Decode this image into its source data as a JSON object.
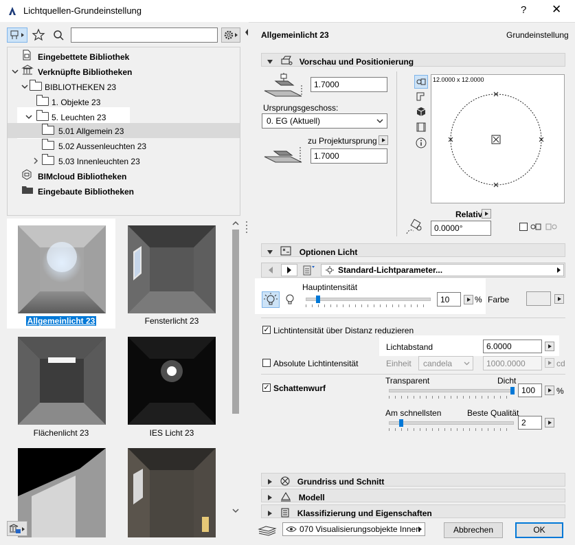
{
  "window": {
    "title": "Lichtquellen-Grundeinstellung",
    "help": "?",
    "close": "✕"
  },
  "left": {
    "search_value": "",
    "tree": [
      {
        "label": "Eingebettete Bibliothek",
        "bold": true
      },
      {
        "label": "Verknüpfte Bibliotheken",
        "bold": true
      },
      {
        "label": "BIBLIOTHEKEN 23"
      },
      {
        "label": "1. Objekte 23"
      },
      {
        "label": "5. Leuchten 23"
      },
      {
        "label": "5.01 Allgemein 23"
      },
      {
        "label": "5.02 Aussenleuchten 23"
      },
      {
        "label": "5.03 Innenleuchten 23"
      },
      {
        "label": "BIMcloud Bibliotheken",
        "bold": true
      },
      {
        "label": "Eingebaute Bibliotheken",
        "bold": true
      }
    ],
    "thumbs": [
      {
        "label": "Allgemeinlicht 23",
        "selected": true
      },
      {
        "label": "Fensterlicht 23"
      },
      {
        "label": "Flächenlicht 23"
      },
      {
        "label": "IES Licht 23"
      }
    ]
  },
  "right": {
    "object_name": "Allgemeinlicht 23",
    "mode": "Grundeinstellung",
    "sec_preview": "Vorschau und Positionierung",
    "elevation": "1.7000",
    "story_label": "Ursprungsgeschoss:",
    "story_value": "0. EG (Aktuell)",
    "proj_label": "zu Projektursprung",
    "proj_value": "1.7000",
    "preview_size": "12.0000 x 12.0000",
    "relativ": "Relativ",
    "angle": "0.0000°",
    "sec_light": "Optionen Licht",
    "page_name": "Standard-Lichtparameter...",
    "intensity_label": "Hauptintensität",
    "intensity_value": "10",
    "intensity_fraction": 0.1,
    "percent": "%",
    "farbe": "Farbe",
    "reduce_label": "Lichtintensität über Distanz reduzieren",
    "lichtabstand_label": "Lichtabstand",
    "lichtabstand_value": "6.0000",
    "absolute_label": "Absolute Lichtintensität",
    "einheit_label": "Einheit",
    "einheit_value": "candela",
    "cd_value": "1000.0000",
    "cd_unit": "cd",
    "schatten_label": "Schattenwurf",
    "transparent": "Transparent",
    "dicht": "Dicht",
    "shadow_value": "100",
    "shadow_fraction": 1.0,
    "schnell": "Am schnellsten",
    "qualitaet": "Beste Qualität",
    "quality_value": "2",
    "quality_fraction": 0.1,
    "sec_grundriss": "Grundriss und Schnitt",
    "sec_modell": "Modell",
    "sec_klass": "Klassifizierung und Eigenschaften",
    "layer": "070 Visualisierungsobjekte Innen",
    "cancel": "Abbrechen",
    "ok": "OK"
  }
}
